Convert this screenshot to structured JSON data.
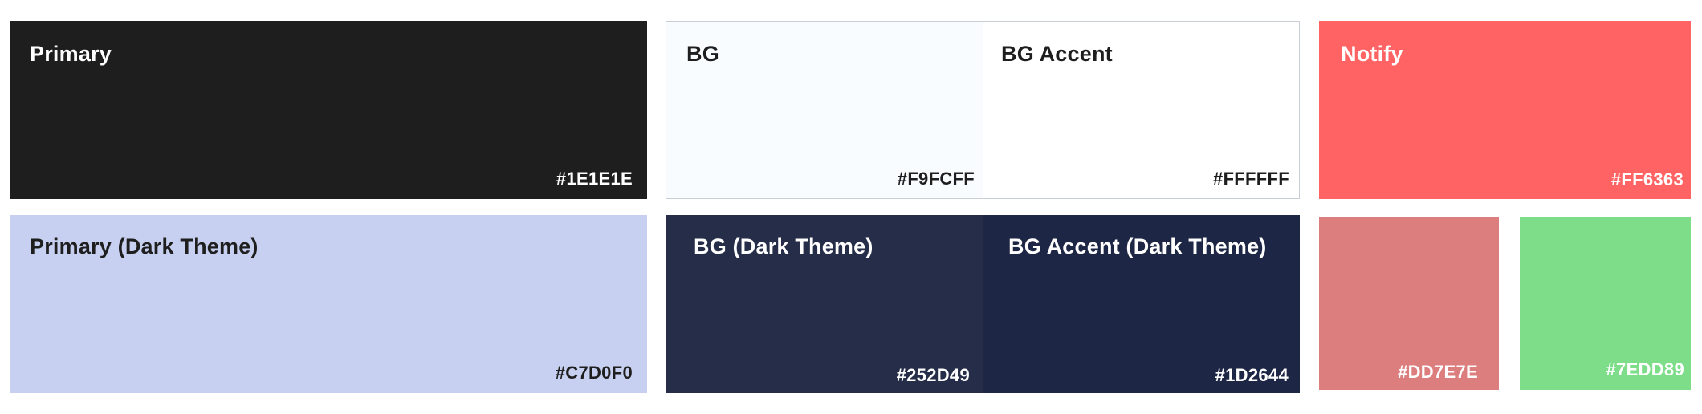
{
  "swatches": {
    "primary": {
      "label": "Primary",
      "hex": "#1E1E1E",
      "color": "#1E1E1E"
    },
    "primary_dark": {
      "label": "Primary (Dark Theme)",
      "hex": "#C7D0F0",
      "color": "#C7D0F0"
    },
    "bg": {
      "label": "BG",
      "hex": "#F9FCFF",
      "color": "#F9FCFF"
    },
    "bg_accent": {
      "label": "BG Accent",
      "hex": "#FFFFFF",
      "color": "#FFFFFF"
    },
    "bg_dark": {
      "label": "BG (Dark Theme)",
      "hex": "#252D49",
      "color": "#252D49"
    },
    "bg_accent_dark": {
      "label": "BG Accent (Dark Theme)",
      "hex": "#1D2644",
      "color": "#1D2644"
    },
    "notify": {
      "label": "Notify",
      "hex": "#FF6363",
      "color": "#FF6363"
    },
    "red_muted": {
      "hex": "#DD7E7E",
      "color": "#DD7E7E"
    },
    "green": {
      "hex": "#7EDD89",
      "color": "#7EDD89"
    }
  },
  "text_colors": {
    "light": "#FFFFFF",
    "dark": "#1E1E1E"
  }
}
